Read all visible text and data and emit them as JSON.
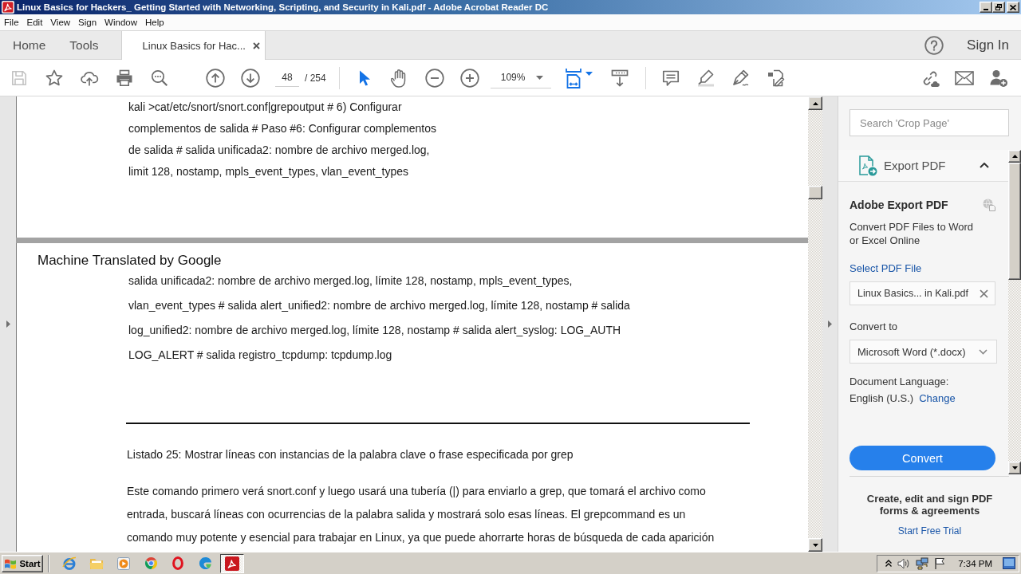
{
  "window": {
    "title": "Linux Basics for Hackers_ Getting Started with Networking, Scripting, and Security in Kali.pdf - Adobe Acrobat Reader DC"
  },
  "menu": [
    "File",
    "Edit",
    "View",
    "Sign",
    "Window",
    "Help"
  ],
  "tabs": [
    {
      "label": "Home",
      "kind": "nav",
      "selected": false
    },
    {
      "label": "Tools",
      "kind": "nav",
      "selected": false
    },
    {
      "label": "Linux Basics for Hac...",
      "kind": "document",
      "selected": true
    }
  ],
  "account": {
    "sign_in": "Sign In"
  },
  "toolbar": {
    "save": {
      "disabled": true
    },
    "page_number": "48",
    "page_total": "/ 254",
    "select_tool": {
      "selected": true
    },
    "hand_tool": {
      "selected": false
    },
    "zoom": "109%"
  },
  "document": {
    "previous_page": {
      "lines": [
        "kali >cat/etc/snort/snort.conf|grepoutput # 6) Configurar",
        "complementos de salida # Paso #6: Configurar complementos",
        "de salida # salida unificada2: nombre de archivo merged.log,",
        "limit 128, nostamp, mpls_event_types, vlan_event_types"
      ]
    },
    "current_page": {
      "banner": "Machine Translated by Google",
      "listing_lines": [
        "salida unificada2: nombre de archivo merged.log, límite 128, nostamp, mpls_event_types,",
        "vlan_event_types # salida alert_unified2: nombre de archivo merged.log, límite 128, nostamp # salida",
        "log_unified2: nombre de archivo merged.log, límite 128, nostamp # salida alert_syslog: LOG_AUTH",
        "LOG_ALERT # salida registro_tcpdump: tcpdump.log"
      ],
      "caption": "Listado 25: Mostrar líneas con instancias de la palabra clave o frase especificada por grep",
      "paragraph_lines": [
        "Este comando primero verá snort.conf y luego usará una tubería (|) para enviarlo a grep, que tomará el archivo como",
        "entrada, buscará líneas con ocurrencias de la palabra salida y mostrará solo esas líneas. El grepcommand es un",
        "comando muy potente y esencial para trabajar en Linux, ya que puede ahorrarte horas de búsqueda de cada aparición"
      ]
    }
  },
  "right_panel": {
    "search": {
      "placeholder": "Search 'Crop Page'"
    },
    "export": {
      "title": "Export PDF",
      "expanded": true,
      "heading": "Adobe Export PDF",
      "description": "Convert PDF Files to Word or Excel Online",
      "select_link": "Select PDF File",
      "file": "Linux Basics... in Kali.pdf",
      "convert_to_label": "Convert to",
      "format": "Microsoft Word (*.docx)",
      "language_label": "Document Language:",
      "language": "English (U.S.)",
      "change_link": "Change",
      "button": "Convert"
    },
    "promo": {
      "text": "Create, edit and sign PDF forms & agreements",
      "link": "Start Free Trial"
    }
  },
  "taskbar": {
    "start": "Start",
    "apps": [
      {
        "selected": false
      },
      {
        "selected": false
      },
      {
        "selected": false
      },
      {
        "selected": false
      },
      {
        "selected": false
      },
      {
        "selected": false
      },
      {
        "selected": true
      }
    ],
    "clock": "7:34 PM"
  }
}
